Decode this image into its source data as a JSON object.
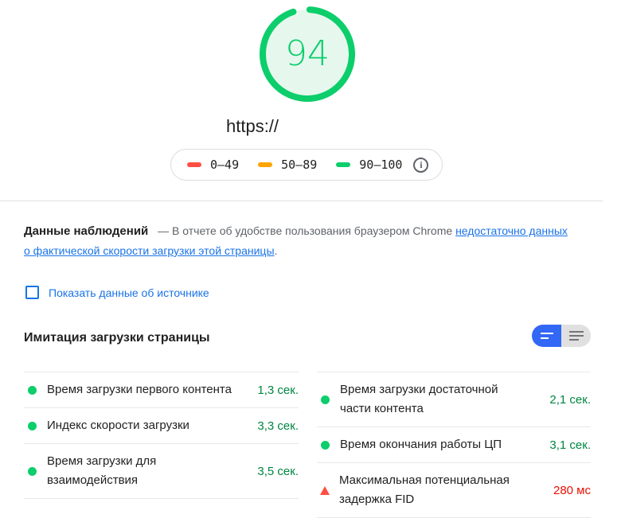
{
  "score": {
    "value": "94",
    "fraction": 0.94,
    "color": "#0cce6b"
  },
  "url": "https://",
  "legend": [
    {
      "label": "0–49",
      "color": "#ff4e42"
    },
    {
      "label": "50–89",
      "color": "#ffa400"
    },
    {
      "label": "90–100",
      "color": "#0cce6b"
    }
  ],
  "field_data": {
    "title": "Данные наблюдений",
    "text": "— В отчете об удобстве пользования браузером Chrome",
    "link": "недостаточно данных о фактической скорости загрузки этой страницы",
    "end": "."
  },
  "show_source_label": "Показать данные об источнике",
  "lab_title": "Имитация загрузки страницы",
  "metrics_left": [
    {
      "label": "Время загрузки первого контента",
      "value": "1,3 сек.",
      "status": "good"
    },
    {
      "label": "Индекс скорости загрузки",
      "value": "3,3 сек.",
      "status": "good"
    },
    {
      "label": "Время загрузки для взаимодействия",
      "value": "3,5 сек.",
      "status": "good"
    }
  ],
  "metrics_right": [
    {
      "label": "Время загрузки достаточной части контента",
      "value": "2,1 сек.",
      "status": "good"
    },
    {
      "label": "Время окончания работы ЦП",
      "value": "3,1 сек.",
      "status": "good"
    },
    {
      "label": "Максимальная потенциальная задержка FID",
      "value": "280 мс",
      "status": "bad"
    }
  ]
}
